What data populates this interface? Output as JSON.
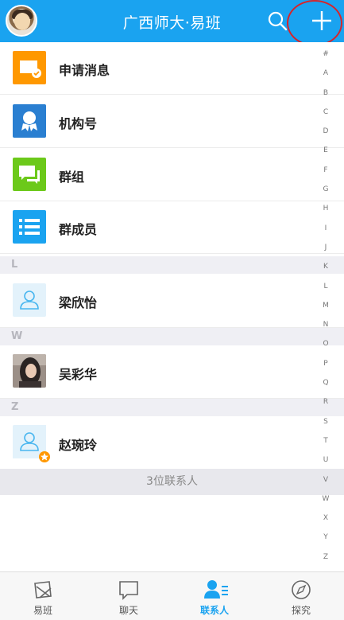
{
  "header": {
    "title": "广西师大·易班"
  },
  "rows": {
    "apply": "申请消息",
    "org": "机构号",
    "group": "群组",
    "members": "群成员"
  },
  "sections": {
    "l": "L",
    "w": "W",
    "z": "Z"
  },
  "contacts": {
    "c1": "梁欣怡",
    "c2": "吴彩华",
    "c3": "赵琬玲"
  },
  "footer": {
    "count": "3位联系人"
  },
  "index": [
    "#",
    "A",
    "B",
    "C",
    "D",
    "E",
    "F",
    "G",
    "H",
    "I",
    "J",
    "K",
    "L",
    "M",
    "N",
    "O",
    "P",
    "Q",
    "R",
    "S",
    "T",
    "U",
    "V",
    "W",
    "X",
    "Y",
    "Z"
  ],
  "tabs": {
    "t1": "易班",
    "t2": "聊天",
    "t3": "联系人",
    "t4": "探究"
  },
  "colors": {
    "accent": "#1aa3f0",
    "orange": "#ff9800",
    "blue": "#2a7fd1",
    "green": "#6cc91a",
    "list_blue": "#1aa3f0"
  }
}
